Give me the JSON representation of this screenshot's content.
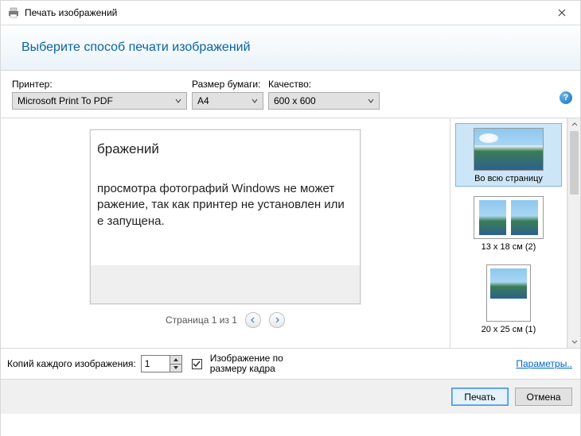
{
  "window": {
    "title": "Печать изображений"
  },
  "banner": {
    "heading": "Выберите способ печати изображений"
  },
  "selectors": {
    "printer_label": "Принтер:",
    "printer_value": "Microsoft Print To PDF",
    "paper_label": "Размер бумаги:",
    "paper_value": "A4",
    "quality_label": "Качество:",
    "quality_value": "600 x 600"
  },
  "preview": {
    "title_fragment": "бражений",
    "body_line1": "просмотра фотографий Windows не может",
    "body_line2": "ражение, так как принтер не установлен или",
    "body_line3": "е запущена.",
    "page_indicator": "Страница 1 из 1"
  },
  "layouts": {
    "full_page": "Во всю страницу",
    "l13x18": "13 x 18 см (2)",
    "l20x25": "20 x 25 см (1)"
  },
  "options": {
    "copies_label": "Копий каждого изображения:",
    "copies_value": "1",
    "fit_label_line1": "Изображение по",
    "fit_label_line2": "размеру кадра",
    "params_link": "Параметры.."
  },
  "footer": {
    "print": "Печать",
    "cancel": "Отмена"
  }
}
